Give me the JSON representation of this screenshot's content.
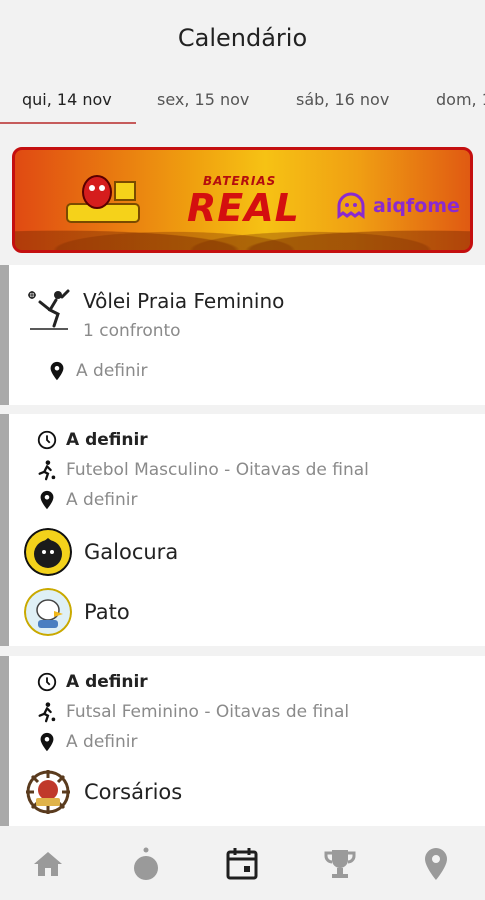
{
  "header": {
    "title": "Calendário"
  },
  "tabs": [
    {
      "label": "qui, 14 nov"
    },
    {
      "label": "sex, 15 nov"
    },
    {
      "label": "sáb, 16 nov"
    },
    {
      "label": "dom, 1"
    }
  ],
  "banner": {
    "brand_small": "BATERIAS",
    "brand_big": "REAL",
    "partner": "aiqfome"
  },
  "events": [
    {
      "sport": "Vôlei Praia Feminino",
      "count": "1 confronto",
      "location": "A definir"
    },
    {
      "time": "A definir",
      "category": "Futebol Masculino - Oitavas de final",
      "location": "A definir",
      "teams": [
        "Galocura",
        "Pato"
      ]
    },
    {
      "time": "A definir",
      "category": "Futsal Feminino - Oitavas de final",
      "location": "A definir",
      "teams": [
        "Corsários"
      ]
    }
  ],
  "nav": {
    "items": [
      "home-icon",
      "ball-icon",
      "calendar-icon",
      "trophy-icon",
      "location-icon"
    ],
    "active_color": "#1f1f1f",
    "inactive_color": "#9a9a9a"
  },
  "colors": {
    "accent_underline": "#c65b5b",
    "banner_border": "#c40f0f"
  }
}
